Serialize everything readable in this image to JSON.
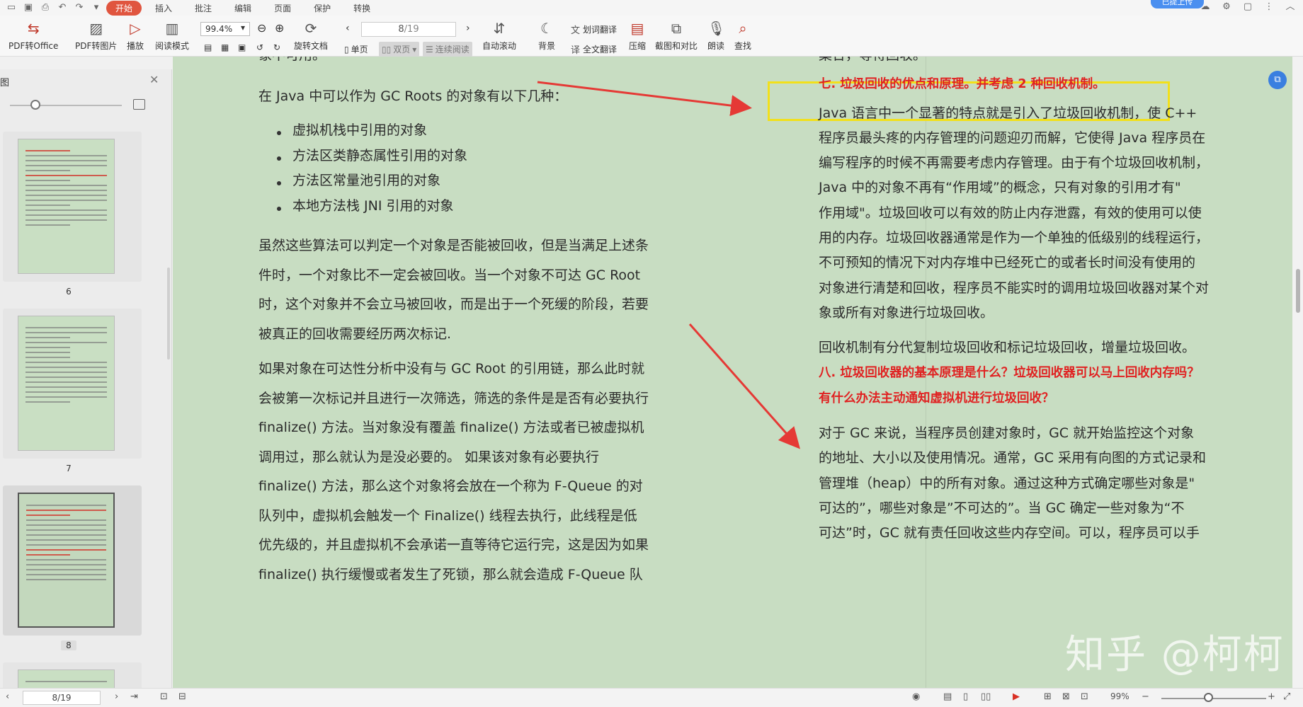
{
  "menubar": {
    "tabs": [
      "开始",
      "插入",
      "批注",
      "编辑",
      "页面",
      "保护",
      "转换"
    ],
    "active_tab": "开始",
    "upload_label": "已提上传"
  },
  "toolbar": {
    "pdf_to_office": "PDF转Office",
    "pdf_to_image": "PDF转图片",
    "play": "播放",
    "read_mode": "阅读模式",
    "zoom": "99.4%",
    "rotate": "旋转文档",
    "page_current": "8",
    "page_total": "/19",
    "single_page": "单页",
    "double_page": "双页",
    "continuous": "连续阅读",
    "auto_scroll": "自动滚动",
    "background": "背景",
    "word_translate": "划词翻译",
    "full_translate": "全文翻译",
    "compress": "压缩",
    "screenshot_compare": "截图和对比",
    "read_aloud": "朗读",
    "find": "查找"
  },
  "sidebar": {
    "title": "图",
    "thumbnails": [
      {
        "label": "6"
      },
      {
        "label": "7"
      },
      {
        "label": "8"
      }
    ]
  },
  "document": {
    "left": {
      "line0": "象不可用。",
      "intro": "在 Java 中可以作为 GC Roots 的对象有以下几种：",
      "bullets": [
        "虚拟机栈中引用的对象",
        "方法区类静态属性引用的对象",
        "方法区常量池引用的对象",
        "本地方法栈 JNI 引用的对象"
      ],
      "para1": [
        "虽然这些算法可以判定一个对象是否能被回收，但是当满足上述条",
        "件时，一个对象比不一定会被回收。当一个对象不可达 GC Root",
        "时，这个对象并不会立马被回收，而是出于一个死缓的阶段，若要",
        "被真正的回收需要经历两次标记."
      ],
      "para2": [
        "如果对象在可达性分析中没有与 GC Root 的引用链，那么此时就",
        "会被第一次标记并且进行一次筛选，筛选的条件是是否有必要执行",
        "finalize() 方法。当对象没有覆盖 finalize() 方法或者已被虚拟机",
        "调用过，那么就认为是没必要的。 如果该对象有必要执行",
        "finalize() 方法，那么这个对象将会放在一个称为 F-Queue 的对",
        "队列中，虚拟机会触发一个 Finalize() 线程去执行，此线程是低",
        "优先级的，并且虚拟机不会承诺一直等待它运行完，这是因为如果",
        "finalize() 执行缓慢或者发生了死锁，那么就会造成 F-Queue 队"
      ]
    },
    "right": {
      "line0": "集合，等待回收。",
      "heading7": "七. 垃圾回收的优点和原理。并考虑 2 种回收机制。",
      "para1": [
        "Java 语言中一个显著的特点就是引入了垃圾回收机制，使 C++",
        "程序员最头疼的内存管理的问题迎刃而解，它使得 Java 程序员在",
        "编写程序的时候不再需要考虑内存管理。由于有个垃圾回收机制，",
        "Java 中的对象不再有“作用域”的概念，只有对象的引用才有\"",
        "作用域\"。垃圾回收可以有效的防止内存泄露，有效的使用可以使",
        "用的内存。垃圾回收器通常是作为一个单独的低级别的线程运行，",
        "不可预知的情况下对内存堆中已经死亡的或者长时间没有使用的",
        "对象进行清楚和回收，程序员不能实时的调用垃圾回收器对某个对",
        "象或所有对象进行垃圾回收。"
      ],
      "para2": "回收机制有分代复制垃圾回收和标记垃圾回收，增量垃圾回收。",
      "heading8a": "八. 垃圾回收器的基本原理是什么？垃圾回收器可以马上回收内存吗？",
      "heading8b": "有什么办法主动通知虚拟机进行垃圾回收？",
      "para3": [
        "对于 GC 来说，当程序员创建对象时，GC 就开始监控这个对象",
        "的地址、大小以及使用情况。通常，GC 采用有向图的方式记录和",
        "管理堆（heap）中的所有对象。通过这种方式确定哪些对象是\"",
        "可达的”，哪些对象是”不可达的”。当 GC 确定一些对象为“不",
        "可达”时，GC 就有责任回收这些内存空间。可以，程序员可以手"
      ]
    },
    "watermark": "知乎 @柯柯"
  },
  "statusbar": {
    "page": "8/19",
    "zoom": "99%"
  },
  "colors": {
    "page_bg": "#c8ddc2",
    "accent_red": "#e02222",
    "highlight_yellow": "#f2e01a",
    "tab_active": "#e0553f"
  }
}
